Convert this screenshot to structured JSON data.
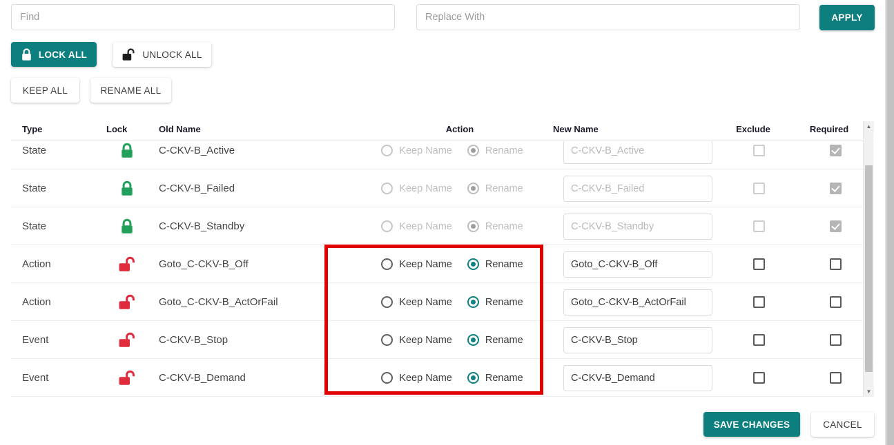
{
  "search": {
    "find_placeholder": "Find",
    "find_value": "",
    "replace_placeholder": "Replace With",
    "replace_value": "",
    "apply_label": "APPLY"
  },
  "toolbar": {
    "lock_all_label": "LOCK ALL",
    "unlock_all_label": "UNLOCK ALL",
    "keep_all_label": "KEEP ALL",
    "rename_all_label": "RENAME ALL"
  },
  "table": {
    "headers": {
      "type": "Type",
      "lock": "Lock",
      "old_name": "Old Name",
      "action": "Action",
      "new_name": "New Name",
      "exclude": "Exclude",
      "required": "Required"
    },
    "action_options": {
      "keep": "Keep Name",
      "rename": "Rename"
    },
    "rows": [
      {
        "type": "State",
        "lock_icon": "lock-closed-icon",
        "locked": true,
        "old_name": "C-CKV-B_Active",
        "action": "rename",
        "new_name": "C-CKV-B_Active",
        "exclude": false,
        "required": true
      },
      {
        "type": "State",
        "lock_icon": "lock-closed-icon",
        "locked": true,
        "old_name": "C-CKV-B_Failed",
        "action": "rename",
        "new_name": "C-CKV-B_Failed",
        "exclude": false,
        "required": true
      },
      {
        "type": "State",
        "lock_icon": "lock-closed-icon",
        "locked": true,
        "old_name": "C-CKV-B_Standby",
        "action": "rename",
        "new_name": "C-CKV-B_Standby",
        "exclude": false,
        "required": true
      },
      {
        "type": "Action",
        "lock_icon": "lock-open-icon",
        "locked": false,
        "old_name": "Goto_C-CKV-B_Off",
        "action": "rename",
        "new_name": "Goto_C-CKV-B_Off",
        "exclude": false,
        "required": false
      },
      {
        "type": "Action",
        "lock_icon": "lock-open-icon",
        "locked": false,
        "old_name": "Goto_C-CKV-B_ActOrFail",
        "action": "rename",
        "new_name": "Goto_C-CKV-B_ActOrFail",
        "exclude": false,
        "required": false
      },
      {
        "type": "Event",
        "lock_icon": "lock-open-icon",
        "locked": false,
        "old_name": "C-CKV-B_Stop",
        "action": "rename",
        "new_name": "C-CKV-B_Stop",
        "exclude": false,
        "required": false
      },
      {
        "type": "Event",
        "lock_icon": "lock-open-icon",
        "locked": false,
        "old_name": "C-CKV-B_Demand",
        "action": "rename",
        "new_name": "C-CKV-B_Demand",
        "exclude": false,
        "required": false
      }
    ]
  },
  "footer": {
    "save_label": "SAVE CHANGES",
    "cancel_label": "CANCEL"
  },
  "colors": {
    "accent_teal": "#0d7f7f",
    "lock_green": "#22a05a",
    "unlock_red": "#e02b3c",
    "highlight_red": "#e00000"
  }
}
